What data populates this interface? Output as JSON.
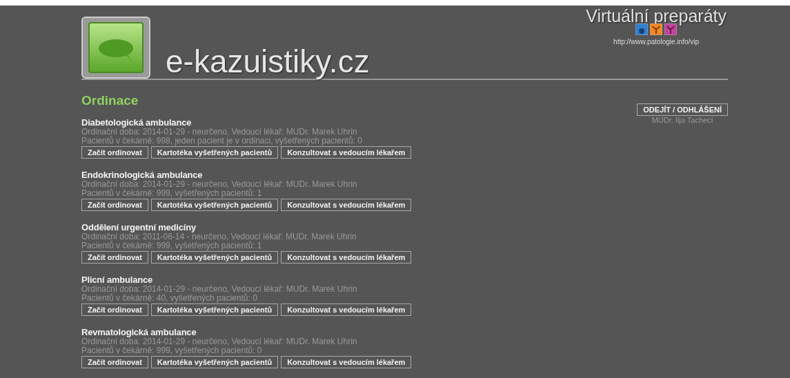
{
  "header": {
    "site_title": "e-kazuistiky.cz",
    "vp_title": "Virtuální preparáty",
    "vp_url": "http://www.patologie.info/vip"
  },
  "heading": "Ordinace",
  "logout": {
    "button": "ODEJÍT / ODHLÁŠENÍ",
    "user": "MUDr. Ilja Tachecí"
  },
  "clinics": [
    {
      "name": "Diabetologická ambulance",
      "hours": "Ordinační doba: 2014-01-29 - neurčeno, Vedoucí lékař: MUDr. Marek Uhrin",
      "patients": "Pacientů v čekárně: 998, jeden pacient je v ordinaci, vyšetřených pacientů: 0",
      "buttons": [
        "Začít ordinovat",
        "Kartotéka vyšetřených pacientů",
        "Konzultovat s vedoucím lékařem"
      ]
    },
    {
      "name": "Endokrinologická ambulance",
      "hours": "Ordinační doba: 2014-01-29 - neurčeno, Vedoucí lékař: MUDr. Marek Uhrin",
      "patients": "Pacientů v čekárně: 999, vyšetřených pacientů: 1",
      "buttons": [
        "Začít ordinovat",
        "Kartotéka vyšetřených pacientů",
        "Konzultovat s vedoucím lékařem"
      ]
    },
    {
      "name": "Oddělení urgentní medicíny",
      "hours": "Ordinační doba: 2011-06-14 - neurčeno, Vedoucí lékař: MUDr. Marek Uhrin",
      "patients": "Pacientů v čekárně: 999, vyšetřených pacientů: 1",
      "buttons": [
        "Začít ordinovat",
        "Kartotéka vyšetřených pacientů",
        "Konzultovat s vedoucím lékařem"
      ]
    },
    {
      "name": "Plicní ambulance",
      "hours": "Ordinační doba: 2014-01-29 - neurčeno, Vedoucí lékař: MUDr. Marek Uhrin",
      "patients": "Pacientů v čekárně: 40, vyšetřených pacientů: 0",
      "buttons": [
        "Začít ordinovat",
        "Kartotéka vyšetřených pacientů",
        "Konzultovat s vedoucím lékařem"
      ]
    },
    {
      "name": "Revmatologická ambulance",
      "hours": "Ordinační doba: 2014-01-29 - neurčeno, Vedoucí lékař: MUDr. Marek Uhrin",
      "patients": "Pacientů v čekárně: 999, vyšetřených pacientů: 0",
      "buttons": [
        "Začít ordinovat",
        "Kartotéka vyšetřených pacientů",
        "Konzultovat s vedoucím lékařem"
      ]
    }
  ]
}
